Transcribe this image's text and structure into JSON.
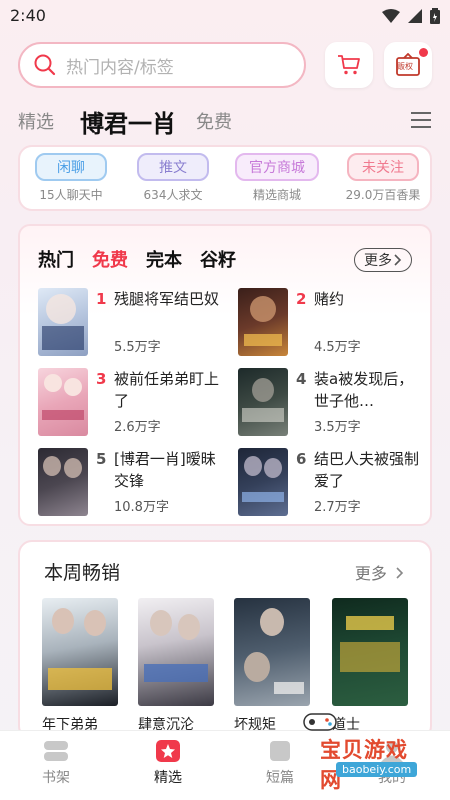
{
  "status": {
    "time": "2:40"
  },
  "search": {
    "placeholder": "热门内容/标签",
    "badge_text": "贩权"
  },
  "tabs": [
    "精选",
    "博君一肖",
    "免费"
  ],
  "quick": [
    {
      "label": "闲聊",
      "sub": "15人聊天中",
      "color": "#4a9ee6",
      "bg": "#e8f3fc"
    },
    {
      "label": "推文",
      "sub": "634人求文",
      "color": "#8a7fd0",
      "bg": "#efedfb"
    },
    {
      "label": "官方商城",
      "sub": "精选商城",
      "color": "#c77ad9",
      "bg": "#f8ecfb"
    },
    {
      "label": "未关注",
      "sub": "29.0万百香果",
      "color": "#f07a8f",
      "bg": "#fdecef"
    }
  ],
  "hot": {
    "tabs": [
      "热门",
      "免费",
      "完本",
      "谷籽"
    ],
    "more": "更多",
    "books": [
      {
        "rank": "1",
        "title": "残腿将军结巴奴",
        "count": "5.5万字",
        "rank_color": "#f0394b"
      },
      {
        "rank": "2",
        "title": "赌约",
        "count": "4.5万字",
        "rank_color": "#f0394b"
      },
      {
        "rank": "3",
        "title": "被前任弟弟盯上了",
        "count": "2.6万字",
        "rank_color": "#f0394b"
      },
      {
        "rank": "4",
        "title": "装a被发现后，世子他…",
        "count": "3.5万字",
        "rank_color": "#555555"
      },
      {
        "rank": "5",
        "title": "[博君一肖]暧昧交锋",
        "count": "10.8万字",
        "rank_color": "#555555"
      },
      {
        "rank": "6",
        "title": "结巴人夫被强制爱了",
        "count": "2.7万字",
        "rank_color": "#555555"
      }
    ]
  },
  "weekly": {
    "title": "本周畅销",
    "more": "更多",
    "books": [
      "年下弟弟",
      "肆意沉沦",
      "坏规矩",
      "道士"
    ]
  },
  "nav": [
    "书架",
    "精选",
    "短篇",
    "我的"
  ],
  "watermark": {
    "text": "宝贝游戏网",
    "url": "baobeiy.com"
  }
}
